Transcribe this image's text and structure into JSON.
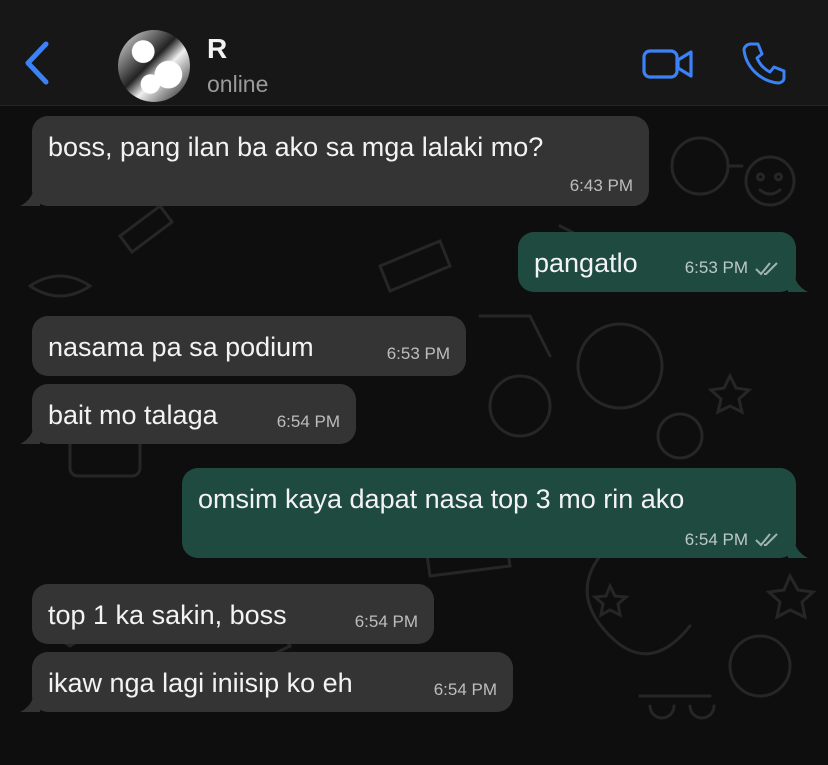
{
  "header": {
    "contact_name": "R",
    "status": "online",
    "icons": [
      "back-chevron-icon",
      "avatar",
      "video-call-icon",
      "voice-call-icon"
    ],
    "accent_color": "#3b82f6"
  },
  "messages": [
    {
      "direction": "incoming",
      "text": "boss, pang ilan ba ako sa mga lalaki mo?",
      "time": "6:43 PM"
    },
    {
      "direction": "outgoing",
      "text": "pangatlo",
      "time": "6:53 PM",
      "receipt": "read-ticks"
    },
    {
      "direction": "incoming",
      "text": "nasama pa sa podium",
      "time": "6:53 PM"
    },
    {
      "direction": "incoming",
      "text": "bait mo talaga",
      "time": "6:54 PM"
    },
    {
      "direction": "outgoing",
      "text": "omsim kaya dapat nasa top 3 mo rin ako",
      "time": "6:54 PM",
      "receipt": "read-ticks"
    },
    {
      "direction": "incoming",
      "text": "top 1 ka sakin, boss",
      "time": "6:54 PM"
    },
    {
      "direction": "incoming",
      "text": "ikaw nga lagi iniisip ko eh",
      "time": "6:54 PM"
    }
  ],
  "colors": {
    "incoming_bubble": "#343434",
    "outgoing_bubble": "#1f4a40",
    "background": "#0d0d0d"
  }
}
